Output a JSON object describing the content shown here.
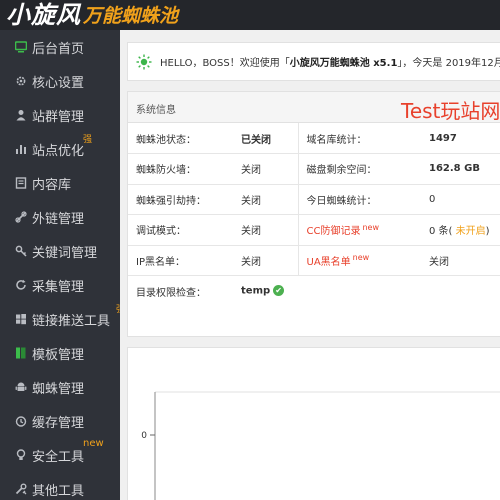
{
  "header": {
    "logo_main": "小旋风",
    "logo_sub": "万能蜘蛛池"
  },
  "sidebar": {
    "items": [
      {
        "label": "后台首页",
        "icon": "monitor-icon",
        "active": true,
        "badge": ""
      },
      {
        "label": "核心设置",
        "icon": "gear-icon",
        "badge": ""
      },
      {
        "label": "站群管理",
        "icon": "user-icon",
        "badge": ""
      },
      {
        "label": "站点优化",
        "icon": "bar-chart-icon",
        "badge": "强"
      },
      {
        "label": "内容库",
        "icon": "document-icon",
        "badge": ""
      },
      {
        "label": "外链管理",
        "icon": "link-icon",
        "badge": ""
      },
      {
        "label": "关键词管理",
        "icon": "key-icon",
        "badge": ""
      },
      {
        "label": "采集管理",
        "icon": "refresh-icon",
        "badge": ""
      },
      {
        "label": "链接推送工具",
        "icon": "windows-icon",
        "badge": "强"
      },
      {
        "label": "模板管理",
        "icon": "template-icon",
        "badge": ""
      },
      {
        "label": "蜘蛛管理",
        "icon": "android-icon",
        "badge": ""
      },
      {
        "label": "缓存管理",
        "icon": "clock-icon",
        "badge": ""
      },
      {
        "label": "安全工具",
        "icon": "bulb-icon",
        "badge": "new"
      },
      {
        "label": "其他工具",
        "icon": "tools-icon",
        "badge": ""
      }
    ]
  },
  "welcome": {
    "prefix": "HELLO，BOSS！欢迎使用「",
    "product": "小旋风万能蜘蛛池 x5.1",
    "suffix": "」，今天是 2019年12月"
  },
  "info": {
    "title": "系统信息",
    "watermark": "Test玩站网",
    "rows": [
      {
        "k1": "蜘蛛池状态：",
        "v1": "已关闭",
        "k2": "域名库统计：",
        "v2": "1497"
      },
      {
        "k1": "蜘蛛防火墙：",
        "v1": "关闭",
        "k2": "磁盘剩余空间：",
        "v2": "162.8 GB"
      },
      {
        "k1": "蜘蛛强引劫持：",
        "v1": "关闭",
        "k2": "今日蜘蛛统计：",
        "v2": "0"
      },
      {
        "k1": "调试模式：",
        "v1": "关闭",
        "k2": "CC防御记录",
        "k2_new": "new",
        "v2": "0 条(",
        "v2_tail": " 未开启",
        "v2_close": ")"
      },
      {
        "k1": "IP黑名单：",
        "v1": "关闭",
        "k2": "UA黑名单",
        "k2_new": "new",
        "v2": "关闭"
      }
    ],
    "dir_check_label": "目录权限检查：",
    "dir_check_value": "temp"
  },
  "chart_data": {
    "type": "line",
    "y_ticks": [
      "0"
    ],
    "series": []
  }
}
